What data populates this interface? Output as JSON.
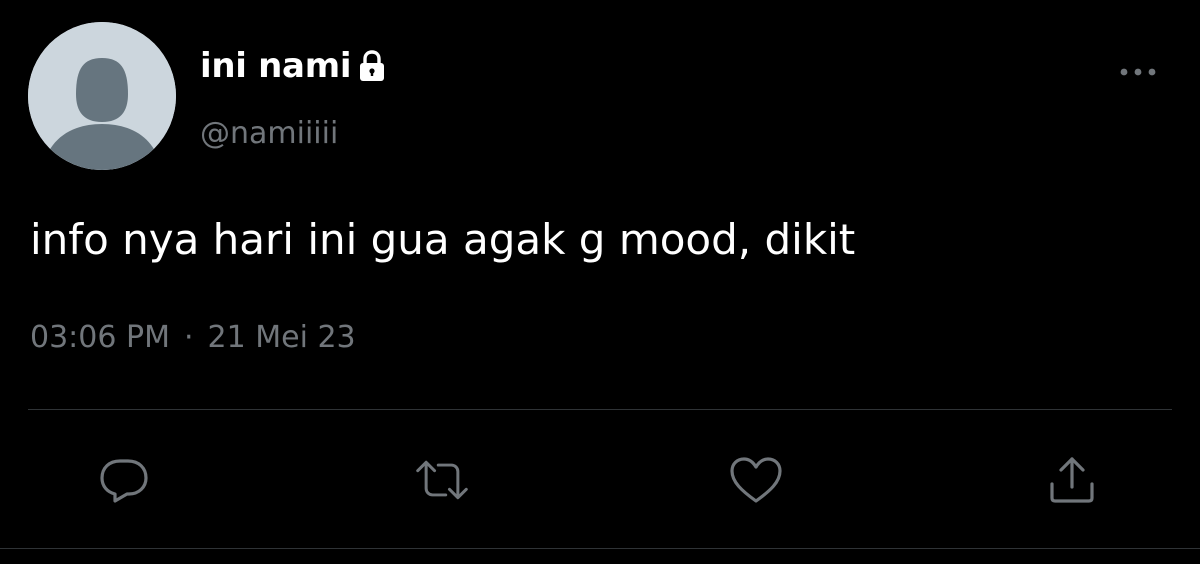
{
  "tweet": {
    "display_name": "ini nami",
    "handle": "@namiiiii",
    "text": "info nya hari ini gua agak g mood, dikit",
    "time": "03:06 PM",
    "separator": "·",
    "date": "21 Mei 23",
    "protected": true
  },
  "icons": {
    "avatar": "default-avatar-icon",
    "lock": "lock-icon",
    "more": "more-options-icon",
    "reply": "reply-icon",
    "retweet": "retweet-icon",
    "like": "like-icon",
    "share": "share-icon"
  },
  "colors": {
    "background": "#000000",
    "primary_text": "#ffffff",
    "secondary_text": "#71767b",
    "divider": "#2f3336",
    "avatar_bg": "#ccd6dd",
    "avatar_fg": "#66757f"
  }
}
